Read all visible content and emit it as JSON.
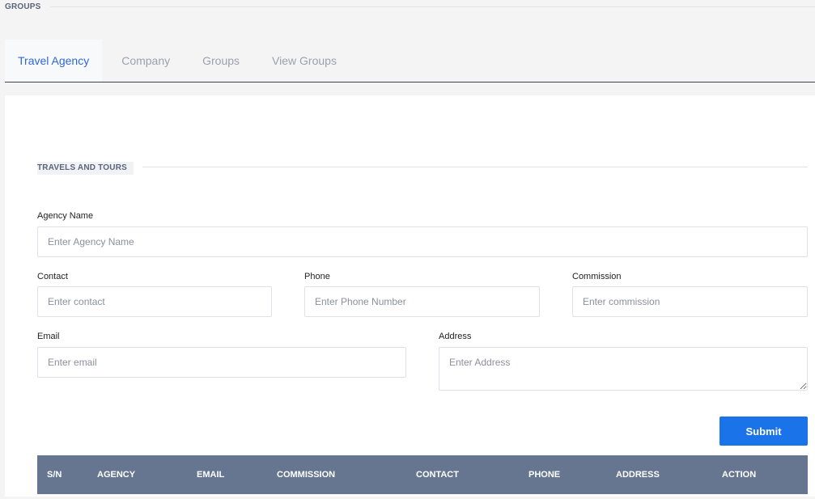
{
  "header": {
    "title": "GROUPS"
  },
  "tabs": [
    {
      "label": "Travel Agency",
      "active": true
    },
    {
      "label": "Company",
      "active": false
    },
    {
      "label": "Groups",
      "active": false
    },
    {
      "label": "View Groups",
      "active": false
    }
  ],
  "form": {
    "section_title": "TRAVELS AND TOURS",
    "agency_name": {
      "label": "Agency Name",
      "placeholder": "Enter Agency Name",
      "value": ""
    },
    "contact": {
      "label": "Contact",
      "placeholder": "Enter contact",
      "value": ""
    },
    "phone": {
      "label": "Phone",
      "placeholder": "Enter Phone Number",
      "value": ""
    },
    "commission": {
      "label": "Commission",
      "placeholder": "Enter commission",
      "value": ""
    },
    "email": {
      "label": "Email",
      "placeholder": "Enter email",
      "value": ""
    },
    "address": {
      "label": "Address",
      "placeholder": "Enter Address",
      "value": ""
    },
    "submit_label": "Submit"
  },
  "table": {
    "columns": [
      "S/N",
      "AGENCY",
      "EMAIL",
      "COMMISSION",
      "CONTACT",
      "PHONE",
      "ADDRESS",
      "ACTION"
    ]
  },
  "colors": {
    "accent": "#1a73e8",
    "active_tab": "#2f67d6",
    "table_header": "#667690"
  }
}
